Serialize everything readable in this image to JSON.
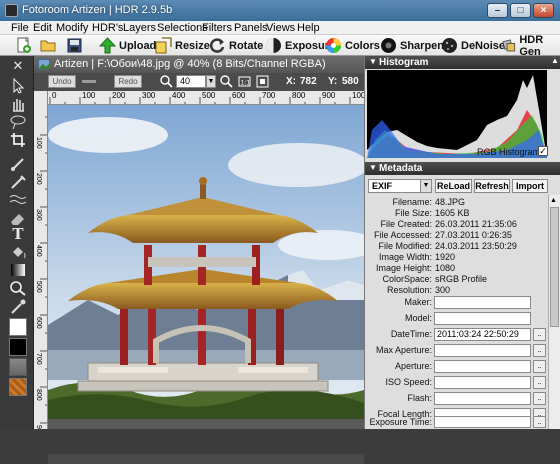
{
  "window": {
    "title": "Fotoroom Artizen | HDR 2.9.5b"
  },
  "menu": [
    "File",
    "Edit",
    "Modify",
    "HDR's",
    "Layers",
    "Selections",
    "Filters",
    "Panels",
    "Views",
    "Help"
  ],
  "toolbar": {
    "upload": "Upload",
    "resize": "Resize",
    "rotate": "Rotate",
    "exposure": "Exposure",
    "colors": "Colors",
    "sharpen": "Sharpen",
    "denoise": "DeNoise",
    "hdr_gen": "HDR Gen"
  },
  "image_window": {
    "title": "Artizen | F:\\Обои\\48.jpg @ 40% (8 Bits/Channel RGBA)",
    "undo": "Undo",
    "redo": "Redo",
    "zoom": "40",
    "x_label": "X:",
    "x_value": "782",
    "y_label": "Y:",
    "y_value": "580",
    "ruler_h": [
      "0",
      "100",
      "200",
      "300",
      "400",
      "500",
      "600",
      "700",
      "800",
      "900",
      "100"
    ],
    "ruler_v": [
      "100",
      "200",
      "300",
      "400",
      "500",
      "600",
      "700",
      "800",
      "900"
    ]
  },
  "histogram": {
    "title": "Histogram",
    "mode_label": "RGB Histogram"
  },
  "metadata": {
    "title": "Metadata",
    "format": "EXIF",
    "reload": "ReLoad",
    "refresh": "Refresh",
    "import": "Import",
    "rows": [
      {
        "label": "Filename:",
        "value": "48.JPG"
      },
      {
        "label": "File Size:",
        "value": "1605 KB"
      },
      {
        "label": "File Created:",
        "value": "26.03.2011 21:35:06"
      },
      {
        "label": "File Accessed:",
        "value": "27.03.2011 0:26:35"
      },
      {
        "label": "File Modified:",
        "value": "24.03.2011 23:50:29"
      },
      {
        "label": "Image Width:",
        "value": "1920"
      },
      {
        "label": "Image Height:",
        "value": "1080"
      },
      {
        "label": "ColorSpace:",
        "value": "sRGB Profile"
      },
      {
        "label": "Resolution:",
        "value": "300"
      }
    ],
    "fields": [
      {
        "label": "Maker:",
        "value": ""
      },
      {
        "label": "Model:",
        "value": ""
      },
      {
        "label": "DateTime:",
        "value": "2011:03:24 22:50:29"
      },
      {
        "label": "Max Aperture:",
        "value": ""
      },
      {
        "label": "Aperture:",
        "value": ""
      },
      {
        "label": "ISO Speed:",
        "value": ""
      },
      {
        "label": "Flash:",
        "value": ""
      },
      {
        "label": "Focal Length:",
        "value": ""
      },
      {
        "label": "Exposure Time:",
        "value": ""
      }
    ],
    "dots": ".."
  },
  "colors": {
    "accent": "#3a6e9b",
    "panel_dark": "#3a3a3a",
    "foreground_swatch": "#ffffff",
    "background_swatch": "#000000"
  }
}
